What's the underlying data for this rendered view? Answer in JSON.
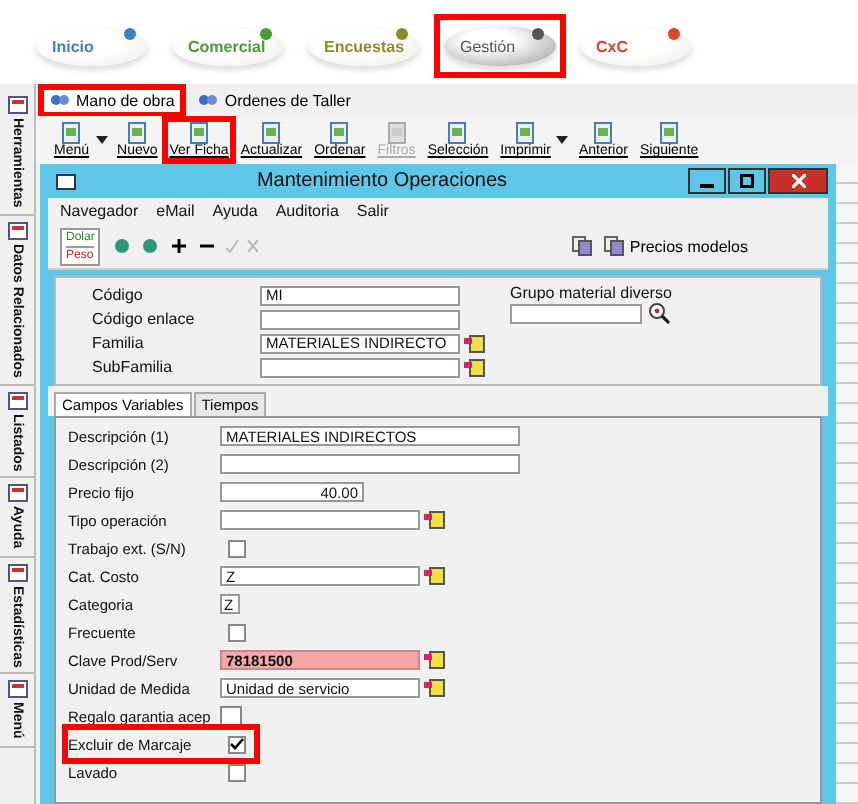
{
  "modules": [
    {
      "label": "Inicio",
      "color": "#3d7fc1",
      "selected": false,
      "highlighted": false
    },
    {
      "label": "Comercial",
      "color": "#4c9a3a",
      "selected": false,
      "highlighted": false
    },
    {
      "label": "Encuestas",
      "color": "#8a8d2a",
      "selected": false,
      "highlighted": false
    },
    {
      "label": "Gestión",
      "color": "#555555",
      "selected": true,
      "highlighted": true
    },
    {
      "label": "CxC",
      "color": "#d9452e",
      "selected": false,
      "highlighted": false
    }
  ],
  "sidebar": {
    "items": [
      {
        "label": "Herramientas"
      },
      {
        "label": "Datos Relacionados"
      },
      {
        "label": "Listados"
      },
      {
        "label": "Ayuda"
      },
      {
        "label": "Estadísticas"
      },
      {
        "label": "Menú"
      }
    ]
  },
  "doc_tabs": [
    {
      "label": "Mano de obra",
      "selected": true,
      "highlighted": true
    },
    {
      "label": "Ordenes de Taller",
      "selected": false,
      "highlighted": false
    }
  ],
  "toolbar": [
    {
      "label": "Menú",
      "disabled": false,
      "dropdown": true,
      "highlighted": false
    },
    {
      "label": "Nuevo",
      "disabled": false,
      "dropdown": false,
      "highlighted": false
    },
    {
      "label": "Ver Ficha",
      "disabled": false,
      "dropdown": false,
      "highlighted": true
    },
    {
      "label": "Actualizar",
      "disabled": false,
      "dropdown": false,
      "highlighted": false
    },
    {
      "label": "Ordenar",
      "disabled": false,
      "dropdown": false,
      "highlighted": false
    },
    {
      "label": "Filtros",
      "disabled": true,
      "dropdown": false,
      "highlighted": false
    },
    {
      "label": "Selección",
      "disabled": false,
      "dropdown": false,
      "highlighted": false
    },
    {
      "label": "Imprimir",
      "disabled": false,
      "dropdown": true,
      "highlighted": false
    },
    {
      "label": "Anterior",
      "disabled": false,
      "dropdown": false,
      "highlighted": false
    },
    {
      "label": "Siguiente",
      "disabled": false,
      "dropdown": false,
      "highlighted": false
    }
  ],
  "window": {
    "title": "Mantenimiento Operaciones",
    "menu": [
      "Navegador",
      "eMail",
      "Ayuda",
      "Auditoria",
      "Salir"
    ],
    "currency": [
      {
        "label": "Dolar",
        "selected": false
      },
      {
        "label": "Peso",
        "selected": true
      }
    ],
    "precios_button": "Precios modelos",
    "header_fields": [
      {
        "label": "Código",
        "value": "MI",
        "lookup": false
      },
      {
        "label": "Código enlace",
        "lookup": false
      },
      {
        "label": "Familia",
        "value": "MATERIALES INDIRECTO",
        "lookup": true
      },
      {
        "label": "SubFamilia",
        "lookup": true
      }
    ],
    "grupo": {
      "label": "Grupo material diverso"
    },
    "tabs": [
      {
        "label": "Campos Variables",
        "selected": true
      },
      {
        "label": "Tiempos",
        "selected": false
      }
    ],
    "rows": [
      {
        "label": "Descripción (1)",
        "kind": "wide",
        "value": "MATERIALES INDIRECTOS",
        "lookup": false,
        "highlighted": false
      },
      {
        "label": "Descripción (2)",
        "kind": "wide",
        "lookup": false,
        "highlighted": false
      },
      {
        "label": "Precio fijo",
        "kind": "number",
        "value": "40.00",
        "lookup": false,
        "highlighted": false
      },
      {
        "label": "Tipo operación",
        "kind": "field",
        "lookup": true,
        "highlighted": false
      },
      {
        "label": "Trabajo ext. (S/N)",
        "kind": "checkbox",
        "checked": false,
        "highlighted": false
      },
      {
        "label": "Cat. Costo",
        "kind": "field",
        "value": "Z",
        "lookup": true,
        "highlighted": false
      },
      {
        "label": "Categoria",
        "kind": "small",
        "value": "Z",
        "lookup": false,
        "highlighted": false
      },
      {
        "label": "Frecuente",
        "kind": "checkbox",
        "checked": false,
        "highlighted": false
      },
      {
        "label": "Clave Prod/Serv",
        "kind": "alert",
        "value": "78181500",
        "lookup": true,
        "highlighted": false
      },
      {
        "label": "Unidad de Medida",
        "kind": "field",
        "value": "Unidad de servicio",
        "lookup": true,
        "highlighted": false
      },
      {
        "label": "Regalo garantia acep",
        "kind": "bigcheck",
        "checked": false,
        "highlighted": false
      },
      {
        "label": "Excluir de Marcaje",
        "kind": "checkbox",
        "checked": true,
        "highlighted": true
      },
      {
        "label": "Lavado",
        "kind": "checkbox",
        "checked": false,
        "highlighted": false
      }
    ]
  }
}
